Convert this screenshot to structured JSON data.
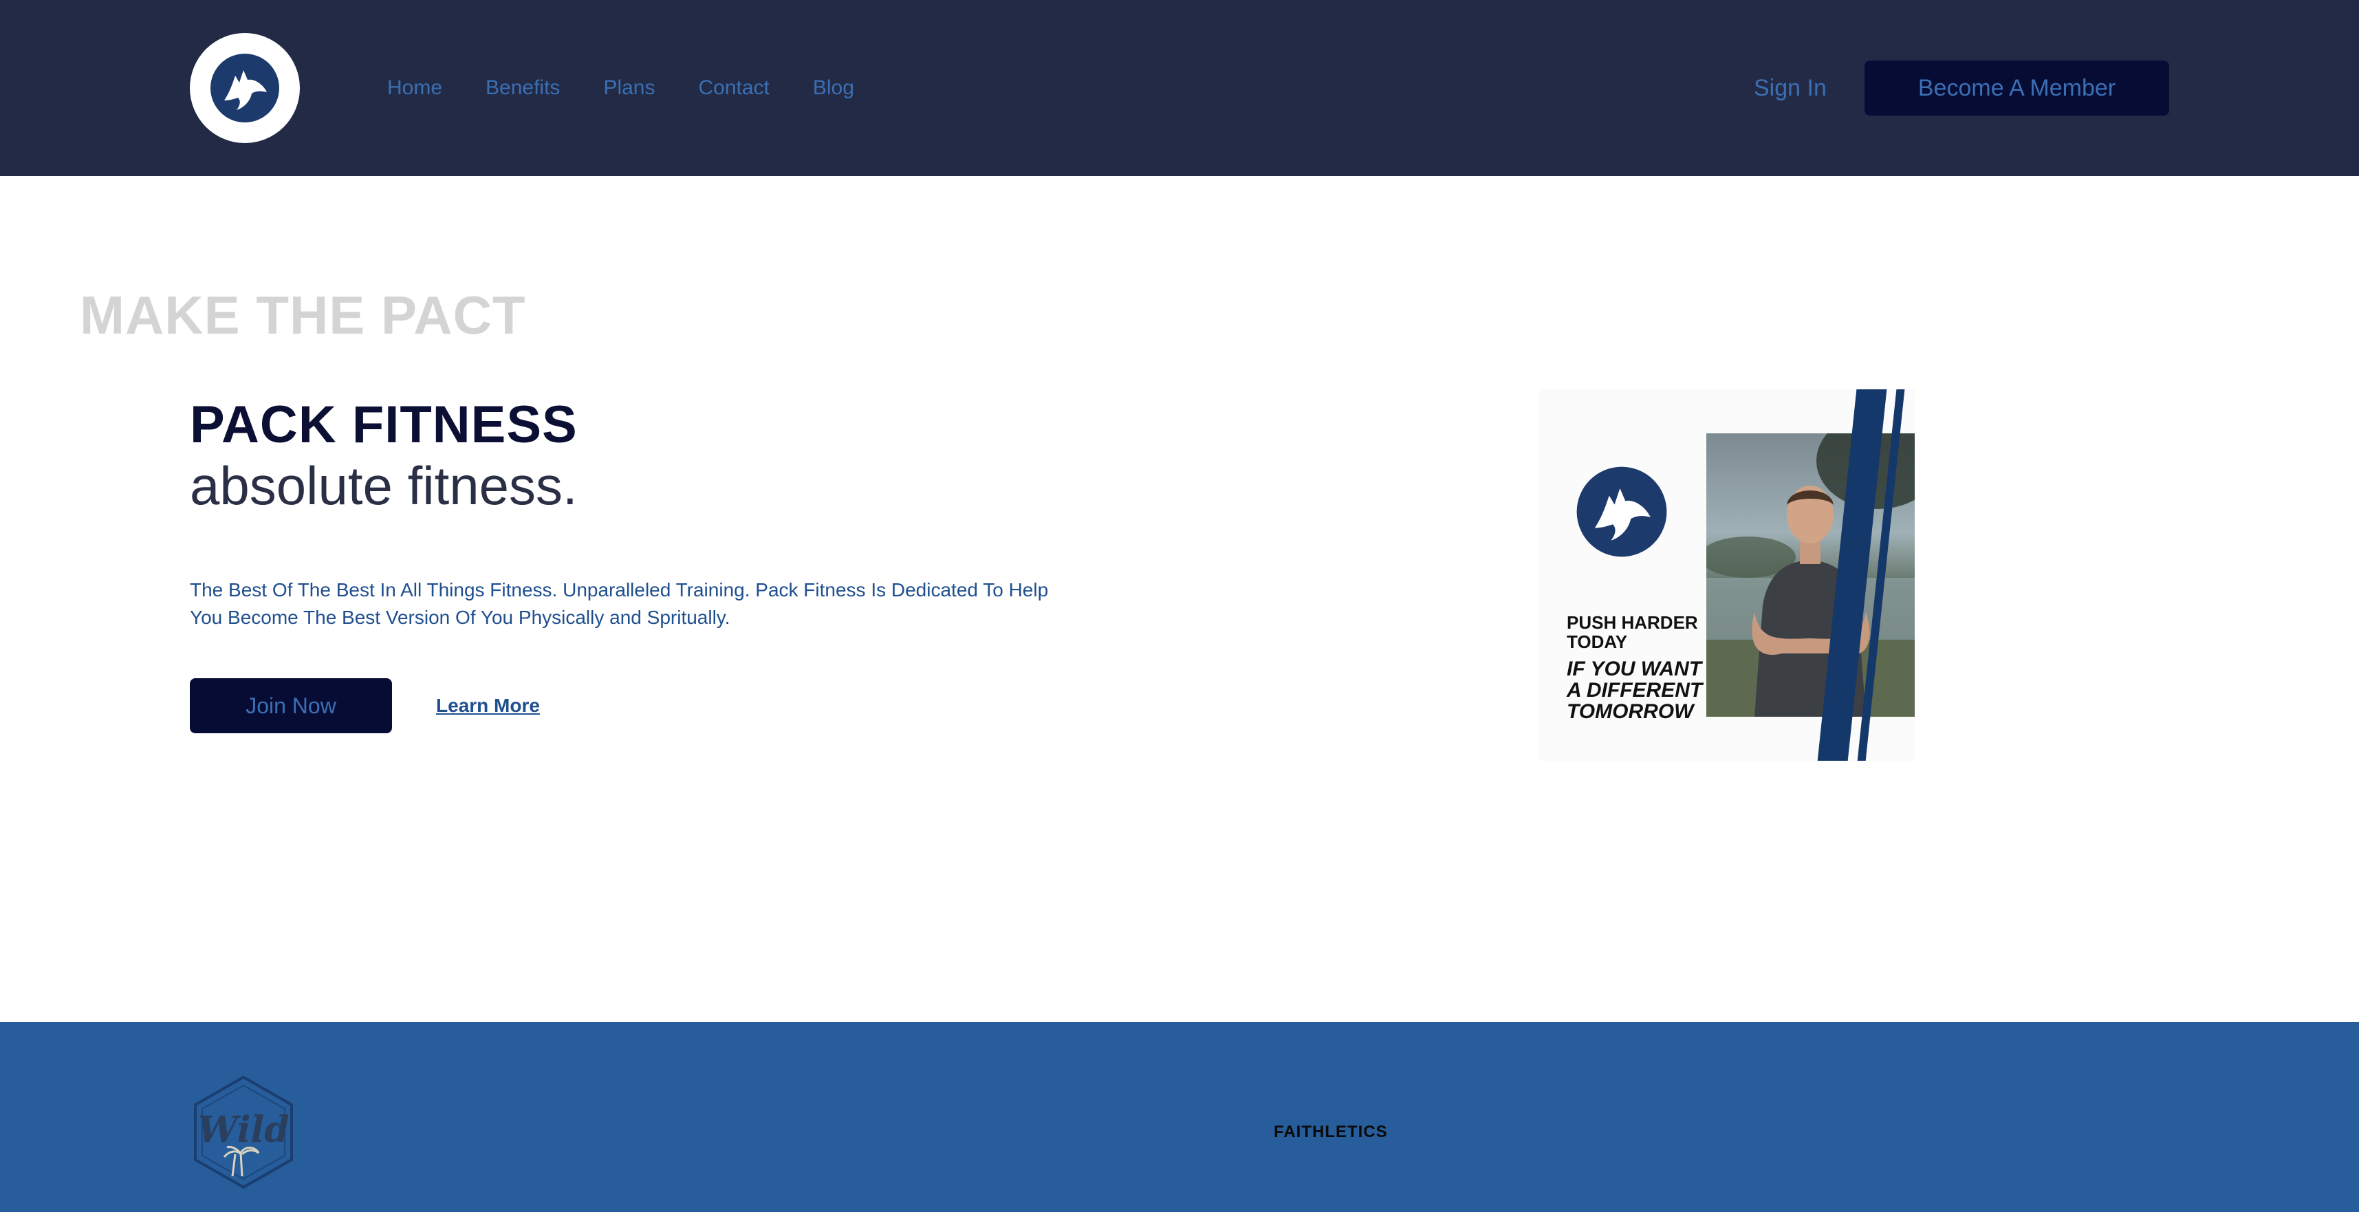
{
  "header": {
    "logo_icon": "wolf-logo-icon",
    "nav": {
      "home": "Home",
      "benefits": "Benefits",
      "plans": "Plans",
      "contact": "Contact",
      "blog": "Blog"
    },
    "sign_in": "Sign In",
    "become_member": "Become A Member"
  },
  "hero": {
    "tagline": "MAKE THE PACT",
    "title": "PACK FITNESS",
    "subtitle": "absolute fitness.",
    "description_line1": "The Best Of The Best In All Things Fitness. Unparalleled Training. Pack Fitness Is Dedicated To Help",
    "description_line2": "You Become The Best Version Of You Physically and Spritually.",
    "join_now": "Join Now",
    "learn_more": "Learn More"
  },
  "promo_card": {
    "line1a": "PUSH HARDER",
    "line1b": "TODAY",
    "line2a": "IF YOU WANT",
    "line2b": "A DIFFERENT",
    "line2c": "TOMORROW"
  },
  "footer": {
    "partner_badge_text": "Wild",
    "partner_logo_text": "FAITHLETICS"
  },
  "colors": {
    "header_bg": "#222a45",
    "accent_text": "#3b6fb4",
    "button_bg": "#070c35",
    "footer_bg": "#265d9a",
    "title_color": "#0b0f33",
    "stripe_blue": "#15386a"
  }
}
